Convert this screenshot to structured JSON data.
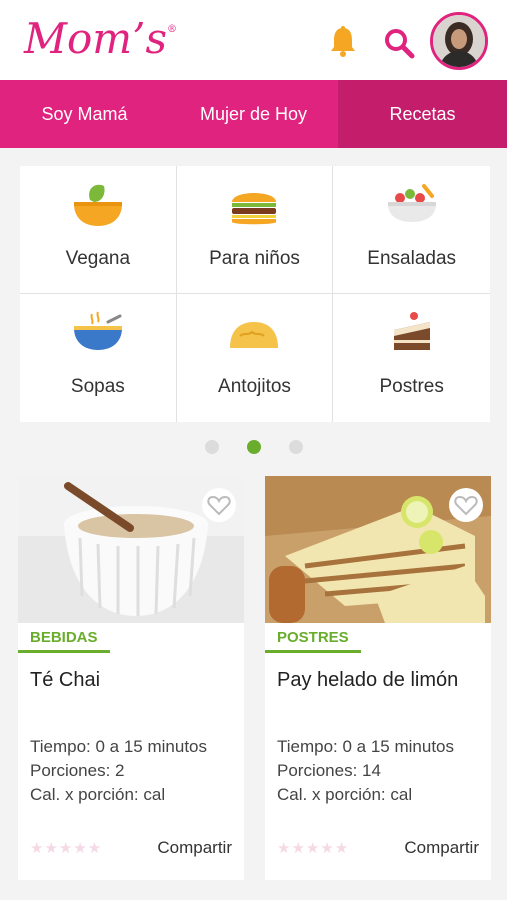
{
  "header": {
    "logo": "Mom’s",
    "logo_mark": "®",
    "icons": [
      "bell-icon",
      "search-icon",
      "avatar"
    ],
    "accent": "#e0237e",
    "bell_color": "#f5a623"
  },
  "tabs": [
    {
      "label": "Soy Mamá",
      "active": false
    },
    {
      "label": "Mujer de Hoy",
      "active": false
    },
    {
      "label": "Recetas",
      "active": true
    }
  ],
  "categories": [
    {
      "label": "Vegana",
      "icon": "vegan-bowl-icon"
    },
    {
      "label": "Para niños",
      "icon": "burger-icon"
    },
    {
      "label": "Ensaladas",
      "icon": "salad-icon"
    },
    {
      "label": "Sopas",
      "icon": "soup-icon"
    },
    {
      "label": "Antojitos",
      "icon": "taco-icon"
    },
    {
      "label": "Postres",
      "icon": "cake-icon"
    }
  ],
  "pagination": {
    "pages": 3,
    "current": 2,
    "active_color": "#6aad2c"
  },
  "recipes": [
    {
      "category": "BEBIDAS",
      "title": "Té Chai",
      "time": "Tiempo: 0 a 15 minutos",
      "portions": "Porciones: 2",
      "calories": "Cal. x porción: cal",
      "share": "Compartir"
    },
    {
      "category": "POSTRES",
      "title": "Pay helado de limón",
      "time": "Tiempo: 0 a 15 minutos",
      "portions": "Porciones: 14",
      "calories": "Cal. x porción: cal",
      "share": "Compartir"
    }
  ]
}
